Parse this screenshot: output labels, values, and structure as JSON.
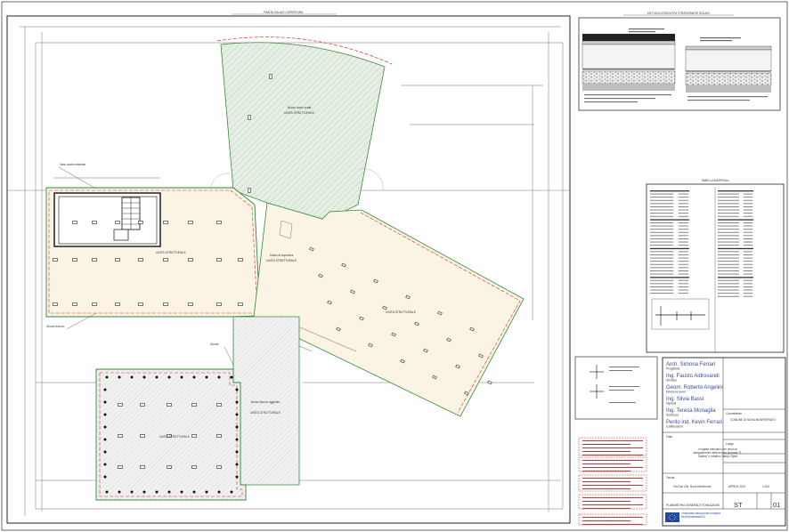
{
  "sheet": {
    "plan_title": "PIANTA SOLAIO COPERTURA",
    "detail_title": "DETTAGLI ESECUTIVI STRATIGRAFIE SOLAIO",
    "table_title": "TABELLA MATERIALI",
    "zone_labels": {
      "green": "Nuovo corpo scala",
      "upper": "Solaio di copertura",
      "lower": "Nuovo blocco",
      "unit": "UNITÀ STRUTTURALE"
    },
    "side_labels": {
      "left_top": "Vano scale esistente",
      "left_mid": "Giunto tecnico",
      "center": "Giunto",
      "lower_mid": "Nuovo blocco aggiunto"
    }
  },
  "title_block": {
    "team": [
      {
        "name": "Arch. Simona Ferrari",
        "role": "Progettista"
      },
      {
        "name": "Ing. Fausto Aldrovandi",
        "role": "Strutture"
      },
      {
        "name": "Geom. Roberto Angelini",
        "role": "Direzione lavori"
      },
      {
        "name": "Ing. Silvia Bassi",
        "role": "Impianti"
      },
      {
        "name": "Ing. Teresa Monaglia",
        "role": "Sicurezza"
      },
      {
        "name": "Perito ind. Kevin Ferrari",
        "role": "Collaboratore"
      }
    ],
    "client": "COMUNE DI NOVA MONFERRATO",
    "client_label": "Committente",
    "project": "Progetto esecutivo per lavori di adeguamento della scuola primaria \"E. Gallina\" e relativo Campo Sport",
    "site_label": "Luogo",
    "site": "Via Don Gai, Nova Monferrato",
    "phase_label": "Fase",
    "drawing_label": "Tavola",
    "drawing_title": "PLANIMETRIA GENERALE FONDAZIONI",
    "date": "APRILE 2021",
    "scale": "1:100",
    "code_letters": "ST",
    "code_number": "01"
  },
  "footer": {
    "funding": "Finanziato dall'Unione europea NextGenerationEU"
  }
}
